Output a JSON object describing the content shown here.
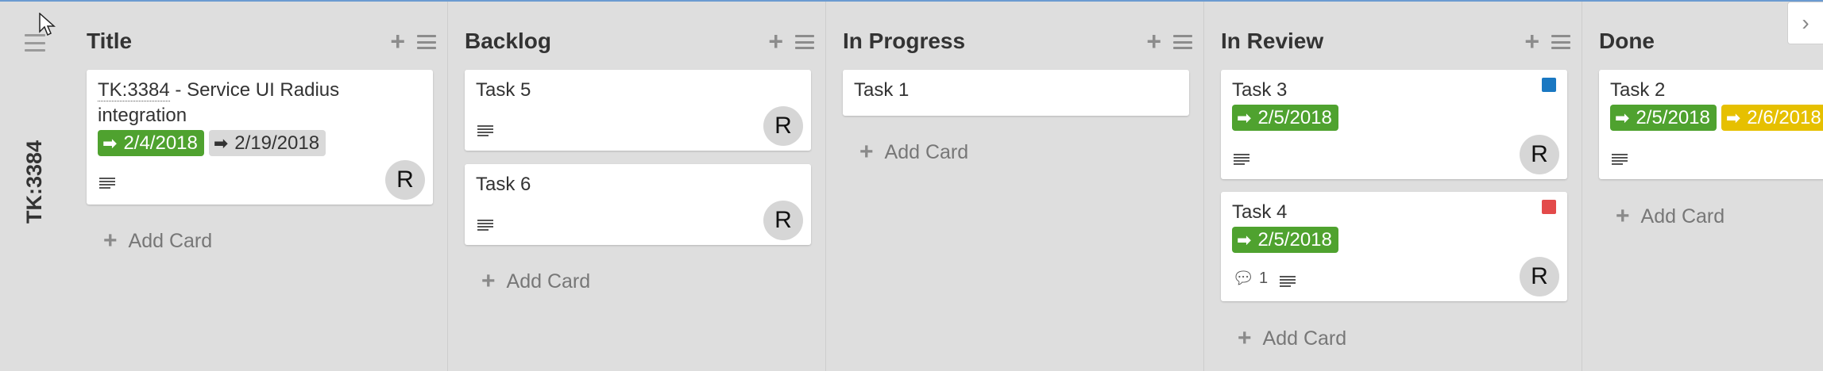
{
  "swimlane": {
    "title": "TK:3384"
  },
  "columns": [
    {
      "title": "Title",
      "add_label": "Add Card",
      "cards": [
        {
          "title_link": "TK:3384",
          "title_rest": " - Service UI Radius integration",
          "badges": [
            {
              "icon": "➔",
              "text": "2/4/2018",
              "style": "green"
            },
            {
              "icon": "→",
              "text": "2/19/2018",
              "style": "gray"
            }
          ],
          "avatar": "R"
        }
      ]
    },
    {
      "title": "Backlog",
      "add_label": "Add Card",
      "cards": [
        {
          "title": "Task 5",
          "avatar": "R"
        },
        {
          "title": "Task 6",
          "avatar": "R"
        }
      ]
    },
    {
      "title": "In Progress",
      "add_label": "Add Card",
      "cards": [
        {
          "title": "Task 1"
        }
      ]
    },
    {
      "title": "In Review",
      "add_label": "Add Card",
      "cards": [
        {
          "title": "Task 3",
          "color": "#1a78c2",
          "badges": [
            {
              "icon": "➔",
              "text": "2/5/2018",
              "style": "green"
            }
          ],
          "avatar": "R"
        },
        {
          "title": "Task 4",
          "color": "#e34a4a",
          "badges": [
            {
              "icon": "➔",
              "text": "2/5/2018",
              "style": "green"
            }
          ],
          "comments": "1",
          "avatar": "R"
        }
      ]
    },
    {
      "title": "Done",
      "add_label": "Add Card",
      "cards": [
        {
          "title": "Task 2",
          "badges": [
            {
              "icon": "➔",
              "text": "2/5/2018",
              "style": "green"
            },
            {
              "icon": "➔",
              "text": "2/6/2018",
              "style": "yellow"
            }
          ]
        }
      ]
    }
  ],
  "icons": {
    "add": "plus-icon",
    "menu": "hamburger-menu-icon",
    "description": "description-lines-icon",
    "comment": "comment-bubble-icon",
    "scroll": "chevron-right-icon"
  },
  "colors": {
    "green": "#4fa22f",
    "yellow": "#e6c000",
    "blue": "#1a78c2",
    "red": "#e34a4a"
  }
}
